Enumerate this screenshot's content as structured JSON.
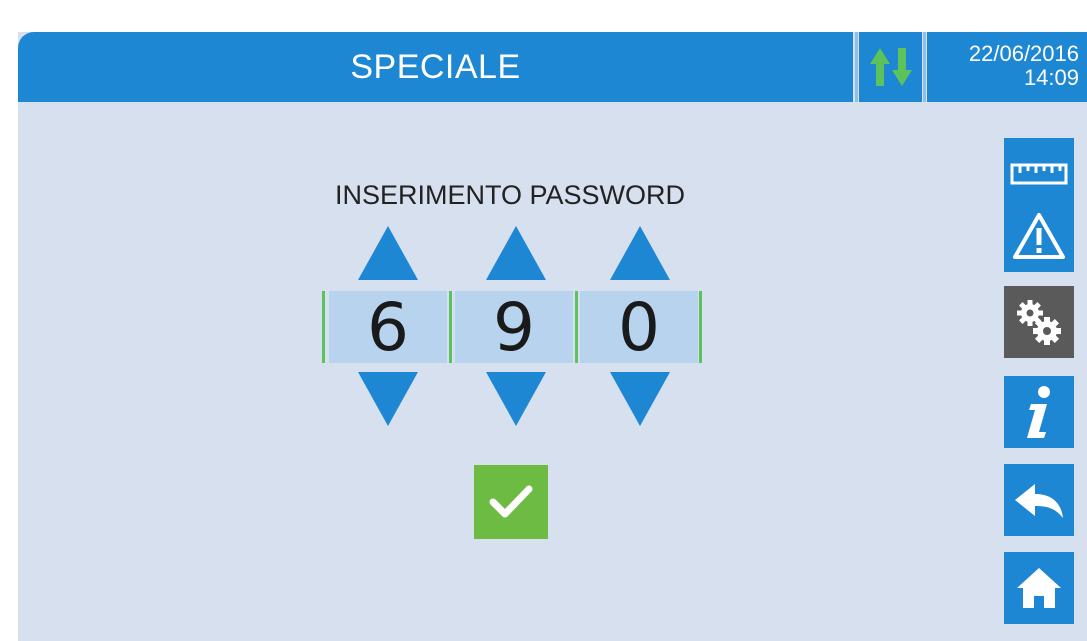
{
  "header": {
    "title": "SPECIALE",
    "date": "22/06/2016",
    "time": "14:09",
    "io_icon": "up-down-arrows-icon"
  },
  "password": {
    "label": "INSERIMENTO PASSWORD",
    "digits": [
      "6",
      "9",
      "0"
    ]
  },
  "sidebar": {
    "items": [
      {
        "name": "measurements",
        "icon": "ruler-icon",
        "active": false
      },
      {
        "name": "alarms",
        "icon": "warning-icon",
        "active": false
      },
      {
        "name": "settings",
        "icon": "gears-icon",
        "active": true
      },
      {
        "name": "info",
        "icon": "info-icon",
        "active": false
      },
      {
        "name": "back",
        "icon": "back-arrow-icon",
        "active": false
      },
      {
        "name": "home",
        "icon": "home-icon",
        "active": false
      }
    ]
  },
  "colors": {
    "accent": "#1e87d3",
    "background": "#d6e0ee",
    "digit_box": "#b8d3ee",
    "confirm": "#6dbb43",
    "active_side": "#5a5a5a",
    "io_arrows": "#5cc25c"
  }
}
